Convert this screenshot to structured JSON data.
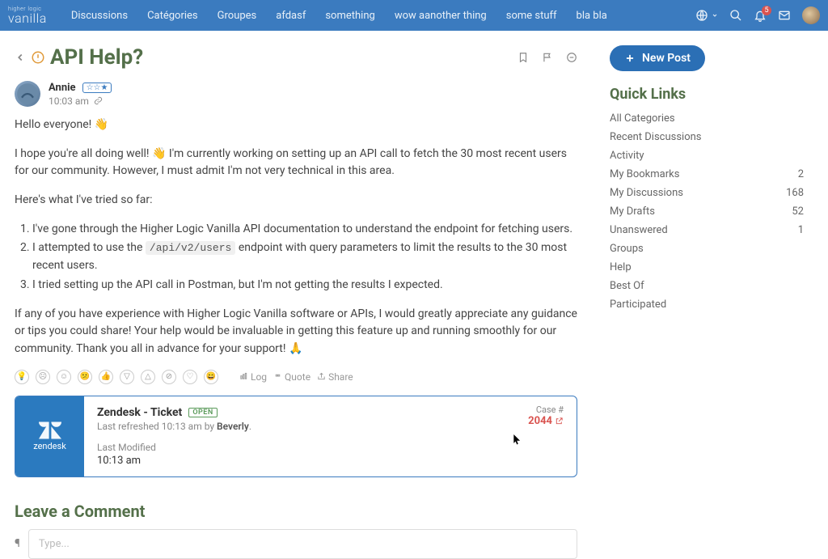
{
  "logo": {
    "top": "higher logic",
    "bottom": "vanilla"
  },
  "nav": [
    "Discussions",
    "Catégories",
    "Groupes",
    "afdasf",
    "something",
    "wow aanother thing",
    "some stuff",
    "bla bla"
  ],
  "notif_count": "5",
  "title": "API Help?",
  "author": {
    "name": "Annie",
    "time": "10:03 am"
  },
  "body": {
    "p1_pre": "Hello everyone! ",
    "p1_emoji": "👋",
    "p2_pre": "I hope you're all doing well! ",
    "p2_emoji": "👋 ",
    "p2_rest": "I'm currently working on setting up an API call to fetch the 30 most recent users for our community. However, I must admit I'm not very technical in this area.",
    "p3": "Here's what I've tried so far:",
    "li1": "I've gone through the Higher Logic Vanilla API documentation to understand the endpoint for fetching users.",
    "li2_pre": "I attempted to use the ",
    "li2_code": "/api/v2/users",
    "li2_post": " endpoint with query parameters to limit the results to the 30 most recent users.",
    "li3": "I tried setting up the API call in Postman, but I'm not getting the results I expected.",
    "p4_pre": "If any of you have experience with Higher Logic Vanilla software or APIs, I would greatly appreciate any guidance or tips you could share! Your help would be invaluable in getting this feature up and running smoothly for our community. Thank you all in advance for your support! ",
    "p4_emoji": "🙏"
  },
  "reactions": {
    "log": "Log",
    "quote": "Quote",
    "share": "Share"
  },
  "zendesk": {
    "brand": "zendesk",
    "title": "Zendesk - Ticket",
    "status": "OPEN",
    "refreshed_pre": "Last refreshed 10:13 am by ",
    "refreshed_by": "Beverly",
    "lastmod_label": "Last Modified",
    "lastmod_time": "10:13 am",
    "case_label": "Case #",
    "case_num": "2044"
  },
  "leave_comment": "Leave a Comment",
  "comment_placeholder": "Type...",
  "newpost": "New Post",
  "quicklinks_title": "Quick Links",
  "quicklinks": [
    {
      "label": "All Categories",
      "count": ""
    },
    {
      "label": "Recent Discussions",
      "count": ""
    },
    {
      "label": "Activity",
      "count": ""
    },
    {
      "label": "My Bookmarks",
      "count": "2"
    },
    {
      "label": "My Discussions",
      "count": "168"
    },
    {
      "label": "My Drafts",
      "count": "52"
    },
    {
      "label": "Unanswered",
      "count": "1"
    },
    {
      "label": "Groups",
      "count": ""
    },
    {
      "label": "Help",
      "count": ""
    },
    {
      "label": "Best Of",
      "count": ""
    },
    {
      "label": "Participated",
      "count": ""
    }
  ]
}
